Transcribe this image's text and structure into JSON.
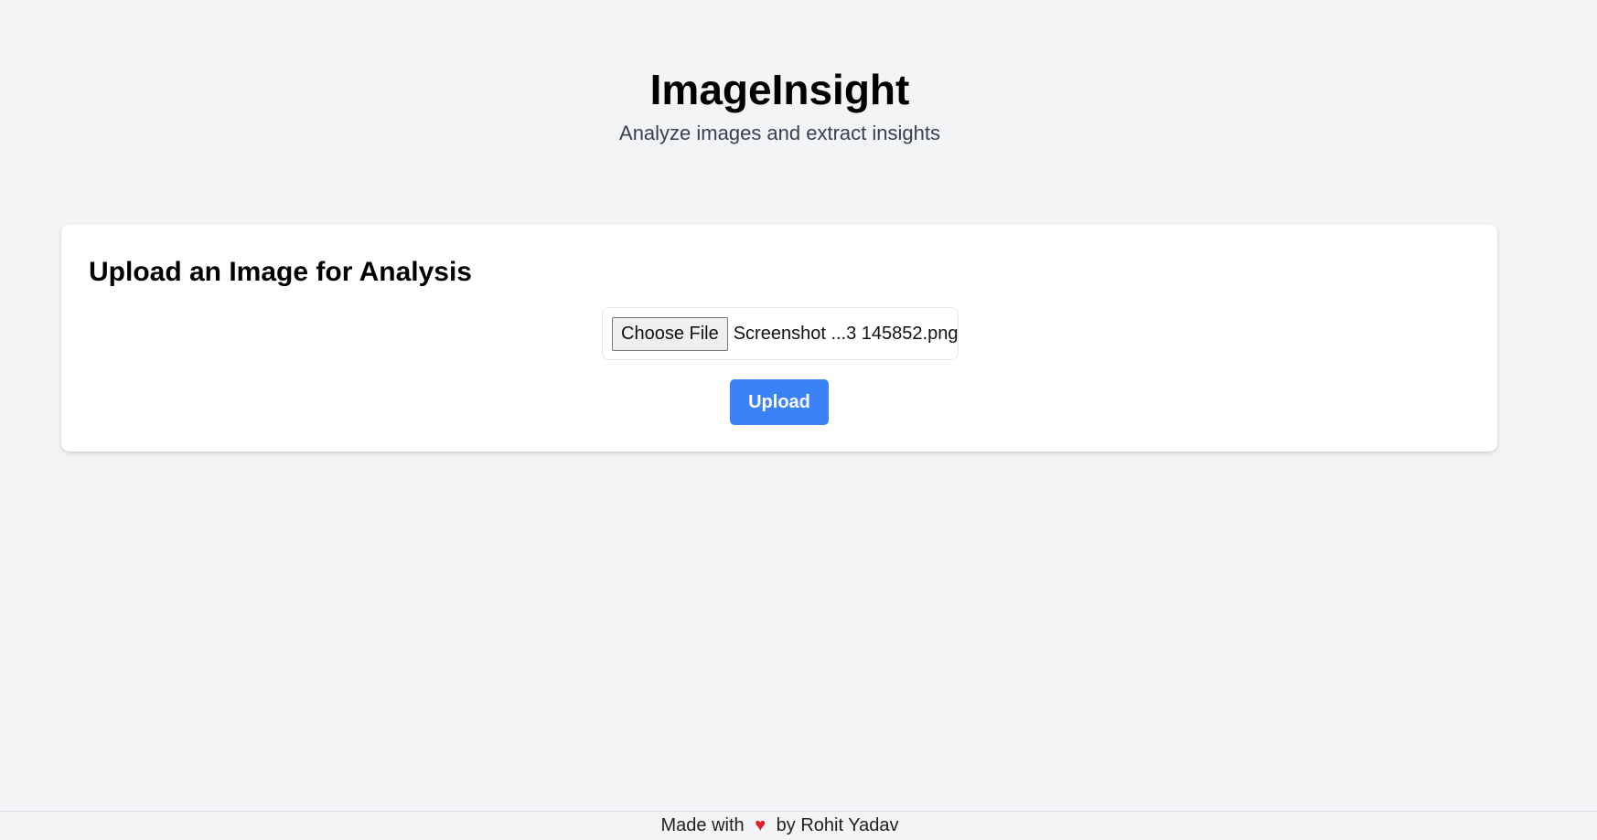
{
  "header": {
    "title": "ImageInsight",
    "subtitle": "Analyze images and extract insights"
  },
  "upload_card": {
    "title": "Upload an Image for Analysis",
    "choose_file_label": "Choose File",
    "file_name": "Screenshot ...3 145852.png",
    "upload_label": "Upload"
  },
  "footer": {
    "made_with": "Made with",
    "heart_icon": "heart-icon",
    "heart_color": "#e11d2e",
    "by_text": "by Rohit Yadav"
  },
  "colors": {
    "background": "#f3f4f6",
    "card": "#ffffff",
    "accent": "#3b82f6"
  }
}
